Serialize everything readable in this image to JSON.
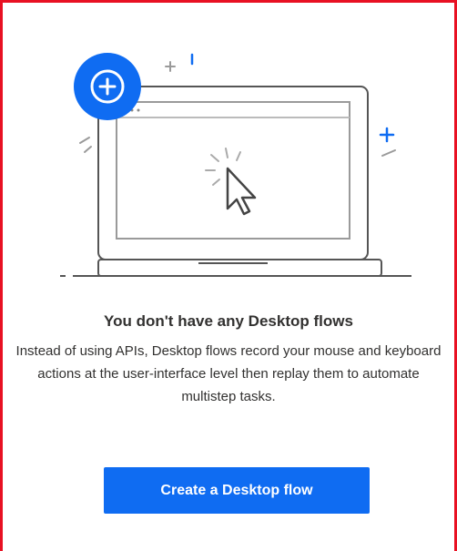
{
  "empty_state": {
    "illustration_icon": "laptop-with-cursor-and-plus-badge",
    "title": "You don't have any Desktop flows",
    "description": "Instead of using APIs, Desktop flows record your mouse and keyboard actions at the user-interface level then replay them to automate multistep tasks.",
    "button_label": "Create a Desktop flow"
  },
  "colors": {
    "accent": "#0f6cf2",
    "frame_border": "#e81123",
    "text": "#323130",
    "line_art": "#5f5f5f"
  }
}
